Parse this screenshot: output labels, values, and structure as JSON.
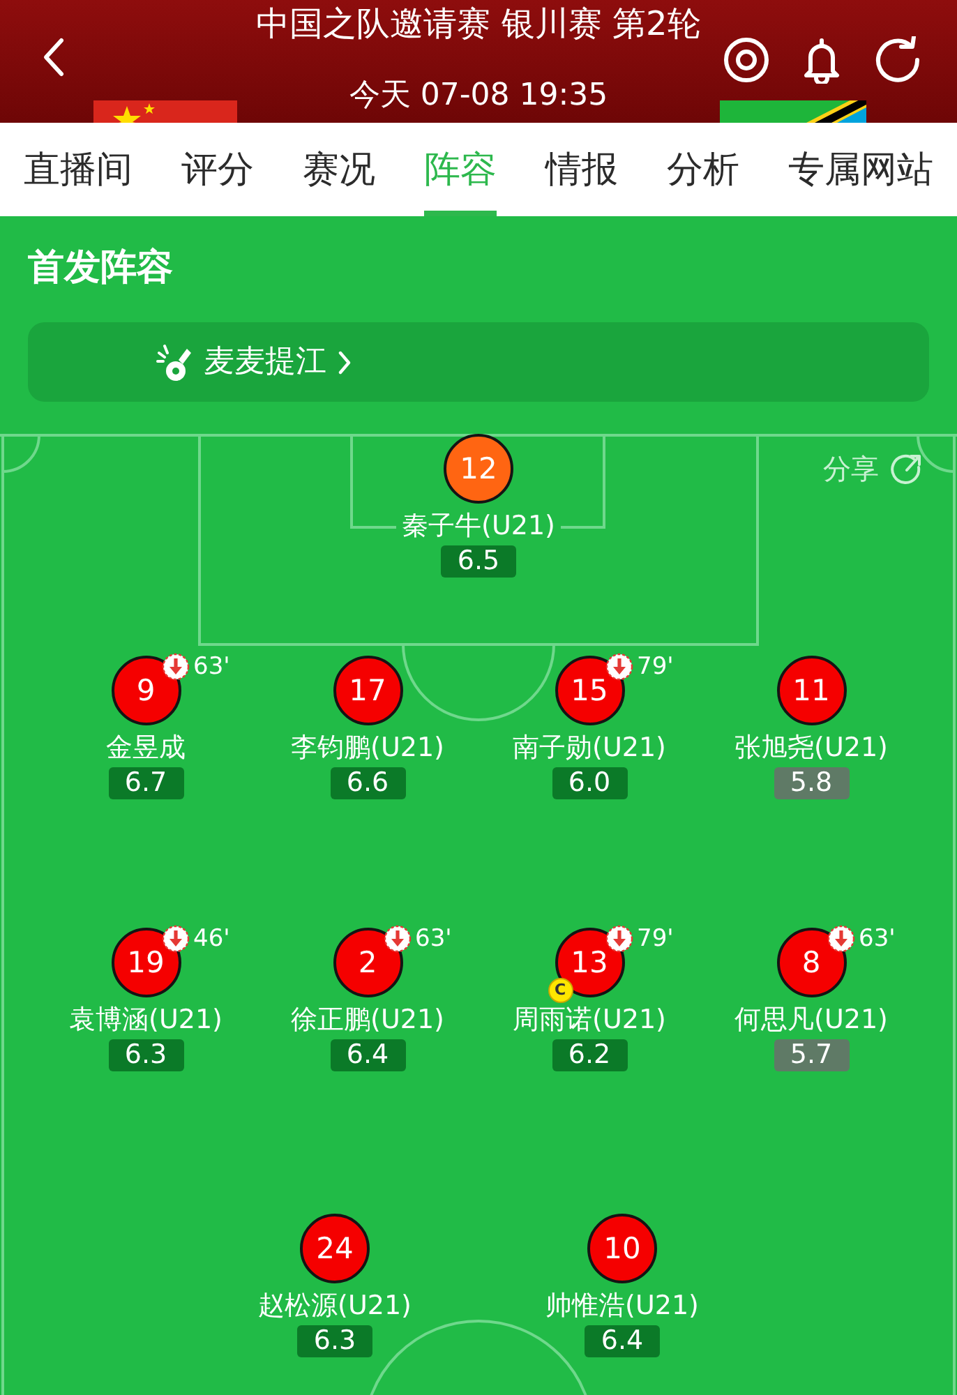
{
  "header": {
    "title": "中国之队邀请赛 银川赛 第2轮",
    "time": "今天 07-08 19:35"
  },
  "tabs": [
    {
      "label": "直播间",
      "selected": false
    },
    {
      "label": "评分",
      "selected": false
    },
    {
      "label": "赛况",
      "selected": false
    },
    {
      "label": "阵容",
      "selected": true
    },
    {
      "label": "情报",
      "selected": false
    },
    {
      "label": "分析",
      "selected": false
    },
    {
      "label": "专属网站",
      "selected": false
    }
  ],
  "lineup": {
    "title": "首发阵容",
    "coach": "麦麦提江",
    "share": "分享",
    "rows": [
      {
        "players": [
          {
            "number": "12",
            "name": "秦子牛(U21)",
            "rating": {
              "text": "6.5",
              "color": "#0b7a28"
            },
            "color": "#ff6512",
            "substituted": false,
            "captain": false
          }
        ]
      },
      {
        "players": [
          {
            "number": "9",
            "name": "金昱成",
            "rating": {
              "text": "6.7",
              "color": "#0b7a28"
            },
            "color": "#f50000",
            "substituted": true,
            "minute": "63'",
            "captain": false
          },
          {
            "number": "17",
            "name": "李钧鹏(U21)",
            "rating": {
              "text": "6.6",
              "color": "#0b7a28"
            },
            "color": "#f50000",
            "substituted": false,
            "captain": false
          },
          {
            "number": "15",
            "name": "南子勋(U21)",
            "rating": {
              "text": "6.0",
              "color": "#0b7a28"
            },
            "color": "#f50000",
            "substituted": true,
            "minute": "79'",
            "captain": false
          },
          {
            "number": "11",
            "name": "张旭尧(U21)",
            "rating": {
              "text": "5.8",
              "color": "#5f7a66"
            },
            "color": "#f50000",
            "substituted": false,
            "captain": false
          }
        ]
      },
      {
        "players": [
          {
            "number": "19",
            "name": "袁博涵(U21)",
            "rating": {
              "text": "6.3",
              "color": "#0b7a28"
            },
            "color": "#f50000",
            "substituted": true,
            "minute": "46'",
            "captain": false
          },
          {
            "number": "2",
            "name": "徐正鹏(U21)",
            "rating": {
              "text": "6.4",
              "color": "#0b7a28"
            },
            "color": "#f50000",
            "substituted": true,
            "minute": "63'",
            "captain": false
          },
          {
            "number": "13",
            "name": "周雨诺(U21)",
            "rating": {
              "text": "6.2",
              "color": "#0b7a28"
            },
            "color": "#f50000",
            "substituted": true,
            "minute": "79'",
            "captain": true,
            "captain_text": "C"
          },
          {
            "number": "8",
            "name": "何思凡(U21)",
            "rating": {
              "text": "5.7",
              "color": "#5f7a66"
            },
            "color": "#f50000",
            "substituted": true,
            "minute": "63'",
            "captain": false
          }
        ]
      },
      {
        "players": [
          {
            "number": "24",
            "name": "赵松源(U21)",
            "rating": {
              "text": "6.3",
              "color": "#0b7a28"
            },
            "color": "#f50000",
            "substituted": false,
            "captain": false
          },
          {
            "number": "10",
            "name": "帅惟浩(U21)",
            "rating": {
              "text": "6.4",
              "color": "#0b7a28"
            },
            "color": "#f50000",
            "substituted": false,
            "captain": false
          }
        ]
      }
    ]
  }
}
